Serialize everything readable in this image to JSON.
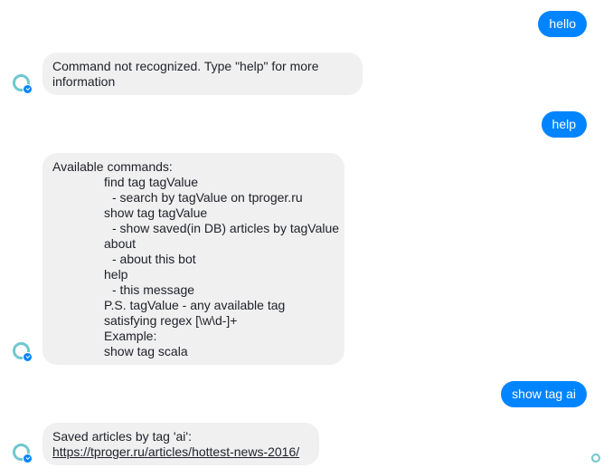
{
  "messages": [
    {
      "from": "user",
      "text": "hello"
    },
    {
      "from": "bot",
      "lines": [
        "Command not recognized. Type \"help\" for more",
        "information"
      ]
    },
    {
      "from": "user",
      "text": "help"
    },
    {
      "from": "bot",
      "lines": [
        "Available commands:",
        "find tag tagValue",
        "- search by tagValue on tproger.ru",
        "show tag tagValue",
        "- show saved(in DB) articles by tagValue",
        "about",
        "- about this bot",
        "help",
        "- this message",
        "P.S. tagValue - any available tag",
        "satisfying regex [\\w\\d-]+",
        "Example:",
        "show tag scala"
      ]
    },
    {
      "from": "user",
      "text": "show tag ai"
    },
    {
      "from": "bot",
      "text": "Saved articles by tag 'ai':",
      "link": "https://tproger.ru/articles/hottest-news-2016/"
    }
  ],
  "colors": {
    "outgoing_bubble": "#0084ff",
    "incoming_bubble": "#f1f0f0",
    "avatar_ring": "#6fc7ce"
  },
  "icons": {
    "bot_avatar": "bot-avatar-icon",
    "delivered_badge": "check-badge-icon",
    "seen_indicator": "seen-avatar-icon"
  }
}
